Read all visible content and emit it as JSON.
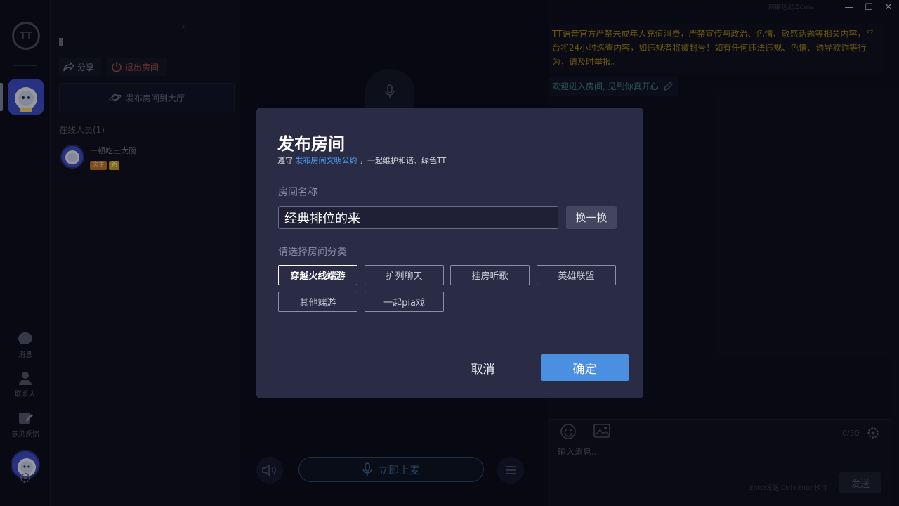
{
  "window": {
    "status": "网络延迟:50ms",
    "min_glyph": "—",
    "max_glyph": "☐",
    "close_glyph": "✕"
  },
  "rail": {
    "logo_text": "TT",
    "items": [
      {
        "label": "消息",
        "icon": "chat-bubble-icon"
      },
      {
        "label": "联系人",
        "icon": "contacts-icon"
      },
      {
        "label": "意见反馈",
        "icon": "feedback-icon"
      }
    ]
  },
  "room": {
    "share_label": "分享",
    "exit_label": "退出房间",
    "publish_bar_label": "发布房间到大厅",
    "online_title": "在线人员(1)",
    "members": [
      {
        "name": "一顿吃三大碗",
        "tags": [
          "房主",
          "新"
        ]
      }
    ]
  },
  "stage": {
    "take_mic_label": "立即上麦"
  },
  "chat": {
    "notice": "TT语音官方严禁未成年人充值消费，严禁宣传与政治、色情、敏感话题等相关内容，平台将24小时巡查内容，如违规者将被封号！如有任何违法违规、色情、诱导欺诈等行为，请及时举报。",
    "welcome": "欢迎进入房间, 见到你真开心",
    "counter": "0/50",
    "input_placeholder": "输入消息...",
    "hint": "Enter发送 Ctrl+Enter换行",
    "send_label": "发送"
  },
  "dialog": {
    "title": "发布房间",
    "subtitle_prefix": "遵守",
    "subtitle_link": "发布房间文明公约",
    "subtitle_suffix": "，一起维护和谐、绿色TT",
    "name_label": "房间名称",
    "name_value": "经典排位的来",
    "refresh_label": "换一换",
    "category_label": "请选择房间分类",
    "categories": [
      {
        "label": "穿越火线端游",
        "selected": true
      },
      {
        "label": "扩列聊天",
        "selected": false
      },
      {
        "label": "挂房听歌",
        "selected": false
      },
      {
        "label": "英雄联盟",
        "selected": false
      },
      {
        "label": "其他端游",
        "selected": false
      },
      {
        "label": "一起pia戏",
        "selected": false
      }
    ],
    "cancel_label": "取消",
    "ok_label": "确定"
  },
  "colors": {
    "accent": "#4a8fe0",
    "dialog_bg": "#2a2b45",
    "notice": "#a08417",
    "danger": "#a34b4b"
  }
}
